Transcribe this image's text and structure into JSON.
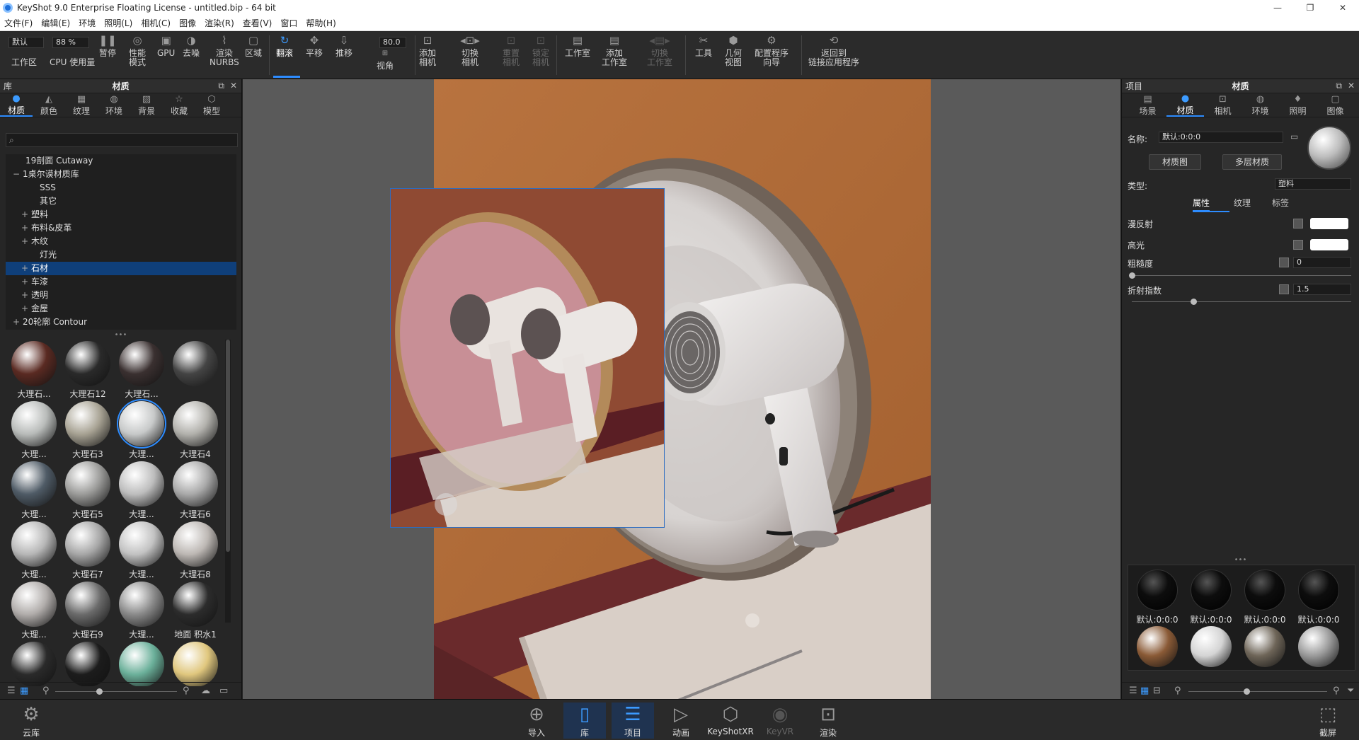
{
  "window": {
    "title": "KeyShot 9.0 Enterprise Floating License  - untitled.bip  - 64 bit",
    "controls": [
      "—",
      "❐",
      "✕"
    ]
  },
  "menu": [
    "文件(F)",
    "编辑(E)",
    "环境",
    "照明(L)",
    "相机(C)",
    "图像",
    "渲染(R)",
    "查看(V)",
    "窗口",
    "帮助(H)"
  ],
  "toolbar": {
    "preset_value": "默认",
    "zoom_value": "88 %",
    "fov_value": "80.0",
    "workspace": "工作区",
    "cpu_usage": "CPU 使用量",
    "pause": "暂停",
    "perf_mode_1": "性能",
    "perf_mode_2": "模式",
    "gpu": "GPU",
    "denoise": "去噪",
    "nurbs_1": "渲染",
    "nurbs_2": "NURBS",
    "region": "区域",
    "tumble": "翻滚",
    "pan": "平移",
    "dolly": "推移",
    "view_angle": "视角",
    "add_camera_1": "添加",
    "add_camera_2": "相机",
    "switch_camera_1": "切换",
    "switch_camera_2": "相机",
    "reset_camera_1": "重置",
    "reset_camera_2": "相机",
    "lock_camera_1": "锁定",
    "lock_camera_2": "相机",
    "studio": "工作室",
    "add_studio_1": "添加",
    "add_studio_2": "工作室",
    "switch_studio_1": "切换",
    "switch_studio_2": "工作室",
    "tools": "工具",
    "geometry_view_1": "几何",
    "geometry_view_2": "视图",
    "config_wizard_1": "配置程序",
    "config_wizard_2": "向导",
    "return_link_1": "返回到",
    "return_link_2": "链接应用程序"
  },
  "library": {
    "header_left": "库",
    "header_center": "材质",
    "tabs": [
      "材质",
      "颜色",
      "纹理",
      "环境",
      "背景",
      "收藏",
      "模型"
    ],
    "search_icon": "⌕",
    "tree": [
      {
        "label": "19剖面 Cutaway",
        "pm": ""
      },
      {
        "label": "1桌尔谟材质库",
        "pm": "−"
      },
      {
        "label": "SSS",
        "pm": ""
      },
      {
        "label": "其它",
        "pm": ""
      },
      {
        "label": "塑料",
        "pm": "+"
      },
      {
        "label": "布料&皮革",
        "pm": "+"
      },
      {
        "label": "木纹",
        "pm": "+"
      },
      {
        "label": "灯光",
        "pm": ""
      },
      {
        "label": "石材",
        "pm": "+"
      },
      {
        "label": "车漆",
        "pm": "+"
      },
      {
        "label": "透明",
        "pm": "+"
      },
      {
        "label": "金屋",
        "pm": "+"
      },
      {
        "label": "20轮廓 Contour",
        "pm": "+"
      }
    ],
    "thumbs": [
      [
        "大理石...",
        "大理石12",
        "大理石...",
        ""
      ],
      [
        "大理...",
        "大理石3",
        "大理...",
        "大理石4"
      ],
      [
        "大理...",
        "大理石5",
        "大理...",
        "大理石6"
      ],
      [
        "大理...",
        "大理石7",
        "大理...",
        "大理石8"
      ],
      [
        "大理...",
        "大理石9",
        "大理...",
        "地面 积水1"
      ],
      [
        "",
        "",
        "",
        ""
      ]
    ],
    "thumb_colors": [
      [
        "#5a2a22",
        "#2a2a2a",
        "#3a3030",
        "#444444"
      ],
      [
        "#b9bcba",
        "#a8a394",
        "#c7c9c9",
        "#b3b2ad"
      ],
      [
        "#4f5b66",
        "#9c9c9a",
        "#bdbdbd",
        "#a9a9a9"
      ],
      [
        "#b7b7b7",
        "#a7a7a7",
        "#c2c2c2",
        "#bdb8b4"
      ],
      [
        "#b1adab",
        "#6b6b6b",
        "#8a8a8a",
        "#2c2c2c"
      ],
      [
        "#2a2a2a",
        "#1c1c1c",
        "#6bb09a",
        "#e0c77e"
      ]
    ]
  },
  "project": {
    "header_left": "项目",
    "header_center": "材质",
    "tabs": [
      "场景",
      "材质",
      "相机",
      "环境",
      "照明",
      "图像"
    ],
    "name_label": "名称:",
    "name_value": "默认:0:0:0",
    "material_graph": "材质图",
    "multi_material": "多层材质",
    "type_label": "类型:",
    "type_value": "塑料",
    "subtabs": [
      "属性",
      "纹理",
      "标签"
    ],
    "diffuse": "漫反射",
    "specular": "高光",
    "roughness": "粗糙度",
    "roughness_value": "0",
    "ior": "折射指数",
    "ior_value": "1.5",
    "roughness_level": 0.0,
    "ior_level": 0.28,
    "swatch_labels": [
      "默认:0:0:0",
      "默认:0:0:0",
      "默认:0:0:0",
      "默认:0:0:0"
    ],
    "swatch_colors_row1": [
      "#0d0d0d",
      "#0d0d0d",
      "#0d0d0d",
      "#0d0d0d"
    ],
    "swatch_colors_row2": [
      "#8a5a36",
      "#d4d4d4",
      "#6e6558",
      "#9a9a9a"
    ]
  },
  "bottombar": {
    "cloud": "云库",
    "import": "导入",
    "library": "库",
    "project": "项目",
    "animation": "动画",
    "keyshotxr": "KeyShotXR",
    "keyvr": "KeyVR",
    "render": "渲染",
    "screenshot": "截屏"
  },
  "colors": {
    "accent": "#2d8cff",
    "panel": "#262626",
    "viewport_bg": "#5a5a5a"
  }
}
